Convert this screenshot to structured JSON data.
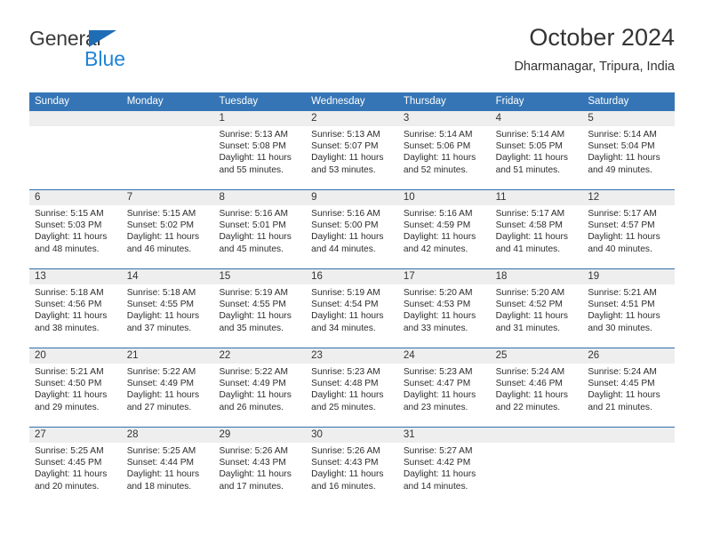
{
  "brand": {
    "name_part1": "General",
    "name_part2": "Blue",
    "logo_icon": "blue-flag-triangle-icon"
  },
  "header": {
    "month_title": "October 2024",
    "location": "Dharmanagar, Tripura, India"
  },
  "colors": {
    "header_blue": "#3575b5",
    "row_divider_blue": "#2f6fae",
    "daynum_band": "#eeeeee",
    "brand_blue": "#1f84d6",
    "logo_blue": "#1f6db5",
    "text": "#2d2d2d"
  },
  "calendar": {
    "weekdays": [
      "Sunday",
      "Monday",
      "Tuesday",
      "Wednesday",
      "Thursday",
      "Friday",
      "Saturday"
    ],
    "weeks": [
      [
        {
          "day": "",
          "lines": []
        },
        {
          "day": "",
          "lines": []
        },
        {
          "day": "1",
          "lines": [
            "Sunrise: 5:13 AM",
            "Sunset: 5:08 PM",
            "Daylight: 11 hours",
            "and 55 minutes."
          ]
        },
        {
          "day": "2",
          "lines": [
            "Sunrise: 5:13 AM",
            "Sunset: 5:07 PM",
            "Daylight: 11 hours",
            "and 53 minutes."
          ]
        },
        {
          "day": "3",
          "lines": [
            "Sunrise: 5:14 AM",
            "Sunset: 5:06 PM",
            "Daylight: 11 hours",
            "and 52 minutes."
          ]
        },
        {
          "day": "4",
          "lines": [
            "Sunrise: 5:14 AM",
            "Sunset: 5:05 PM",
            "Daylight: 11 hours",
            "and 51 minutes."
          ]
        },
        {
          "day": "5",
          "lines": [
            "Sunrise: 5:14 AM",
            "Sunset: 5:04 PM",
            "Daylight: 11 hours",
            "and 49 minutes."
          ]
        }
      ],
      [
        {
          "day": "6",
          "lines": [
            "Sunrise: 5:15 AM",
            "Sunset: 5:03 PM",
            "Daylight: 11 hours",
            "and 48 minutes."
          ]
        },
        {
          "day": "7",
          "lines": [
            "Sunrise: 5:15 AM",
            "Sunset: 5:02 PM",
            "Daylight: 11 hours",
            "and 46 minutes."
          ]
        },
        {
          "day": "8",
          "lines": [
            "Sunrise: 5:16 AM",
            "Sunset: 5:01 PM",
            "Daylight: 11 hours",
            "and 45 minutes."
          ]
        },
        {
          "day": "9",
          "lines": [
            "Sunrise: 5:16 AM",
            "Sunset: 5:00 PM",
            "Daylight: 11 hours",
            "and 44 minutes."
          ]
        },
        {
          "day": "10",
          "lines": [
            "Sunrise: 5:16 AM",
            "Sunset: 4:59 PM",
            "Daylight: 11 hours",
            "and 42 minutes."
          ]
        },
        {
          "day": "11",
          "lines": [
            "Sunrise: 5:17 AM",
            "Sunset: 4:58 PM",
            "Daylight: 11 hours",
            "and 41 minutes."
          ]
        },
        {
          "day": "12",
          "lines": [
            "Sunrise: 5:17 AM",
            "Sunset: 4:57 PM",
            "Daylight: 11 hours",
            "and 40 minutes."
          ]
        }
      ],
      [
        {
          "day": "13",
          "lines": [
            "Sunrise: 5:18 AM",
            "Sunset: 4:56 PM",
            "Daylight: 11 hours",
            "and 38 minutes."
          ]
        },
        {
          "day": "14",
          "lines": [
            "Sunrise: 5:18 AM",
            "Sunset: 4:55 PM",
            "Daylight: 11 hours",
            "and 37 minutes."
          ]
        },
        {
          "day": "15",
          "lines": [
            "Sunrise: 5:19 AM",
            "Sunset: 4:55 PM",
            "Daylight: 11 hours",
            "and 35 minutes."
          ]
        },
        {
          "day": "16",
          "lines": [
            "Sunrise: 5:19 AM",
            "Sunset: 4:54 PM",
            "Daylight: 11 hours",
            "and 34 minutes."
          ]
        },
        {
          "day": "17",
          "lines": [
            "Sunrise: 5:20 AM",
            "Sunset: 4:53 PM",
            "Daylight: 11 hours",
            "and 33 minutes."
          ]
        },
        {
          "day": "18",
          "lines": [
            "Sunrise: 5:20 AM",
            "Sunset: 4:52 PM",
            "Daylight: 11 hours",
            "and 31 minutes."
          ]
        },
        {
          "day": "19",
          "lines": [
            "Sunrise: 5:21 AM",
            "Sunset: 4:51 PM",
            "Daylight: 11 hours",
            "and 30 minutes."
          ]
        }
      ],
      [
        {
          "day": "20",
          "lines": [
            "Sunrise: 5:21 AM",
            "Sunset: 4:50 PM",
            "Daylight: 11 hours",
            "and 29 minutes."
          ]
        },
        {
          "day": "21",
          "lines": [
            "Sunrise: 5:22 AM",
            "Sunset: 4:49 PM",
            "Daylight: 11 hours",
            "and 27 minutes."
          ]
        },
        {
          "day": "22",
          "lines": [
            "Sunrise: 5:22 AM",
            "Sunset: 4:49 PM",
            "Daylight: 11 hours",
            "and 26 minutes."
          ]
        },
        {
          "day": "23",
          "lines": [
            "Sunrise: 5:23 AM",
            "Sunset: 4:48 PM",
            "Daylight: 11 hours",
            "and 25 minutes."
          ]
        },
        {
          "day": "24",
          "lines": [
            "Sunrise: 5:23 AM",
            "Sunset: 4:47 PM",
            "Daylight: 11 hours",
            "and 23 minutes."
          ]
        },
        {
          "day": "25",
          "lines": [
            "Sunrise: 5:24 AM",
            "Sunset: 4:46 PM",
            "Daylight: 11 hours",
            "and 22 minutes."
          ]
        },
        {
          "day": "26",
          "lines": [
            "Sunrise: 5:24 AM",
            "Sunset: 4:45 PM",
            "Daylight: 11 hours",
            "and 21 minutes."
          ]
        }
      ],
      [
        {
          "day": "27",
          "lines": [
            "Sunrise: 5:25 AM",
            "Sunset: 4:45 PM",
            "Daylight: 11 hours",
            "and 20 minutes."
          ]
        },
        {
          "day": "28",
          "lines": [
            "Sunrise: 5:25 AM",
            "Sunset: 4:44 PM",
            "Daylight: 11 hours",
            "and 18 minutes."
          ]
        },
        {
          "day": "29",
          "lines": [
            "Sunrise: 5:26 AM",
            "Sunset: 4:43 PM",
            "Daylight: 11 hours",
            "and 17 minutes."
          ]
        },
        {
          "day": "30",
          "lines": [
            "Sunrise: 5:26 AM",
            "Sunset: 4:43 PM",
            "Daylight: 11 hours",
            "and 16 minutes."
          ]
        },
        {
          "day": "31",
          "lines": [
            "Sunrise: 5:27 AM",
            "Sunset: 4:42 PM",
            "Daylight: 11 hours",
            "and 14 minutes."
          ]
        },
        {
          "day": "",
          "lines": []
        },
        {
          "day": "",
          "lines": []
        }
      ]
    ]
  }
}
